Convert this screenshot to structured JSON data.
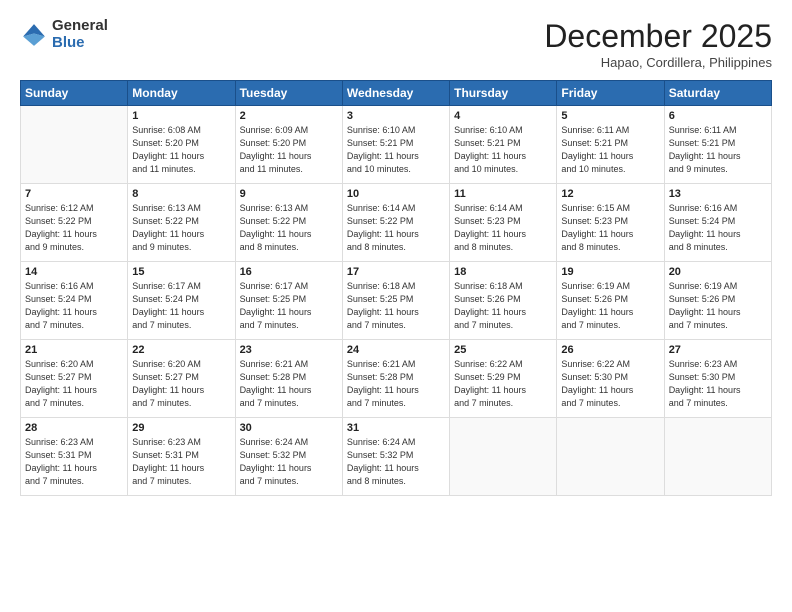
{
  "logo": {
    "general": "General",
    "blue": "Blue"
  },
  "header": {
    "month": "December 2025",
    "location": "Hapao, Cordillera, Philippines"
  },
  "days_of_week": [
    "Sunday",
    "Monday",
    "Tuesday",
    "Wednesday",
    "Thursday",
    "Friday",
    "Saturday"
  ],
  "weeks": [
    [
      {
        "day": "",
        "info": ""
      },
      {
        "day": "1",
        "info": "Sunrise: 6:08 AM\nSunset: 5:20 PM\nDaylight: 11 hours\nand 11 minutes."
      },
      {
        "day": "2",
        "info": "Sunrise: 6:09 AM\nSunset: 5:20 PM\nDaylight: 11 hours\nand 11 minutes."
      },
      {
        "day": "3",
        "info": "Sunrise: 6:10 AM\nSunset: 5:21 PM\nDaylight: 11 hours\nand 10 minutes."
      },
      {
        "day": "4",
        "info": "Sunrise: 6:10 AM\nSunset: 5:21 PM\nDaylight: 11 hours\nand 10 minutes."
      },
      {
        "day": "5",
        "info": "Sunrise: 6:11 AM\nSunset: 5:21 PM\nDaylight: 11 hours\nand 10 minutes."
      },
      {
        "day": "6",
        "info": "Sunrise: 6:11 AM\nSunset: 5:21 PM\nDaylight: 11 hours\nand 9 minutes."
      }
    ],
    [
      {
        "day": "7",
        "info": "Sunrise: 6:12 AM\nSunset: 5:22 PM\nDaylight: 11 hours\nand 9 minutes."
      },
      {
        "day": "8",
        "info": "Sunrise: 6:13 AM\nSunset: 5:22 PM\nDaylight: 11 hours\nand 9 minutes."
      },
      {
        "day": "9",
        "info": "Sunrise: 6:13 AM\nSunset: 5:22 PM\nDaylight: 11 hours\nand 8 minutes."
      },
      {
        "day": "10",
        "info": "Sunrise: 6:14 AM\nSunset: 5:22 PM\nDaylight: 11 hours\nand 8 minutes."
      },
      {
        "day": "11",
        "info": "Sunrise: 6:14 AM\nSunset: 5:23 PM\nDaylight: 11 hours\nand 8 minutes."
      },
      {
        "day": "12",
        "info": "Sunrise: 6:15 AM\nSunset: 5:23 PM\nDaylight: 11 hours\nand 8 minutes."
      },
      {
        "day": "13",
        "info": "Sunrise: 6:16 AM\nSunset: 5:24 PM\nDaylight: 11 hours\nand 8 minutes."
      }
    ],
    [
      {
        "day": "14",
        "info": "Sunrise: 6:16 AM\nSunset: 5:24 PM\nDaylight: 11 hours\nand 7 minutes."
      },
      {
        "day": "15",
        "info": "Sunrise: 6:17 AM\nSunset: 5:24 PM\nDaylight: 11 hours\nand 7 minutes."
      },
      {
        "day": "16",
        "info": "Sunrise: 6:17 AM\nSunset: 5:25 PM\nDaylight: 11 hours\nand 7 minutes."
      },
      {
        "day": "17",
        "info": "Sunrise: 6:18 AM\nSunset: 5:25 PM\nDaylight: 11 hours\nand 7 minutes."
      },
      {
        "day": "18",
        "info": "Sunrise: 6:18 AM\nSunset: 5:26 PM\nDaylight: 11 hours\nand 7 minutes."
      },
      {
        "day": "19",
        "info": "Sunrise: 6:19 AM\nSunset: 5:26 PM\nDaylight: 11 hours\nand 7 minutes."
      },
      {
        "day": "20",
        "info": "Sunrise: 6:19 AM\nSunset: 5:26 PM\nDaylight: 11 hours\nand 7 minutes."
      }
    ],
    [
      {
        "day": "21",
        "info": "Sunrise: 6:20 AM\nSunset: 5:27 PM\nDaylight: 11 hours\nand 7 minutes."
      },
      {
        "day": "22",
        "info": "Sunrise: 6:20 AM\nSunset: 5:27 PM\nDaylight: 11 hours\nand 7 minutes."
      },
      {
        "day": "23",
        "info": "Sunrise: 6:21 AM\nSunset: 5:28 PM\nDaylight: 11 hours\nand 7 minutes."
      },
      {
        "day": "24",
        "info": "Sunrise: 6:21 AM\nSunset: 5:28 PM\nDaylight: 11 hours\nand 7 minutes."
      },
      {
        "day": "25",
        "info": "Sunrise: 6:22 AM\nSunset: 5:29 PM\nDaylight: 11 hours\nand 7 minutes."
      },
      {
        "day": "26",
        "info": "Sunrise: 6:22 AM\nSunset: 5:30 PM\nDaylight: 11 hours\nand 7 minutes."
      },
      {
        "day": "27",
        "info": "Sunrise: 6:23 AM\nSunset: 5:30 PM\nDaylight: 11 hours\nand 7 minutes."
      }
    ],
    [
      {
        "day": "28",
        "info": "Sunrise: 6:23 AM\nSunset: 5:31 PM\nDaylight: 11 hours\nand 7 minutes."
      },
      {
        "day": "29",
        "info": "Sunrise: 6:23 AM\nSunset: 5:31 PM\nDaylight: 11 hours\nand 7 minutes."
      },
      {
        "day": "30",
        "info": "Sunrise: 6:24 AM\nSunset: 5:32 PM\nDaylight: 11 hours\nand 7 minutes."
      },
      {
        "day": "31",
        "info": "Sunrise: 6:24 AM\nSunset: 5:32 PM\nDaylight: 11 hours\nand 8 minutes."
      },
      {
        "day": "",
        "info": ""
      },
      {
        "day": "",
        "info": ""
      },
      {
        "day": "",
        "info": ""
      }
    ]
  ]
}
